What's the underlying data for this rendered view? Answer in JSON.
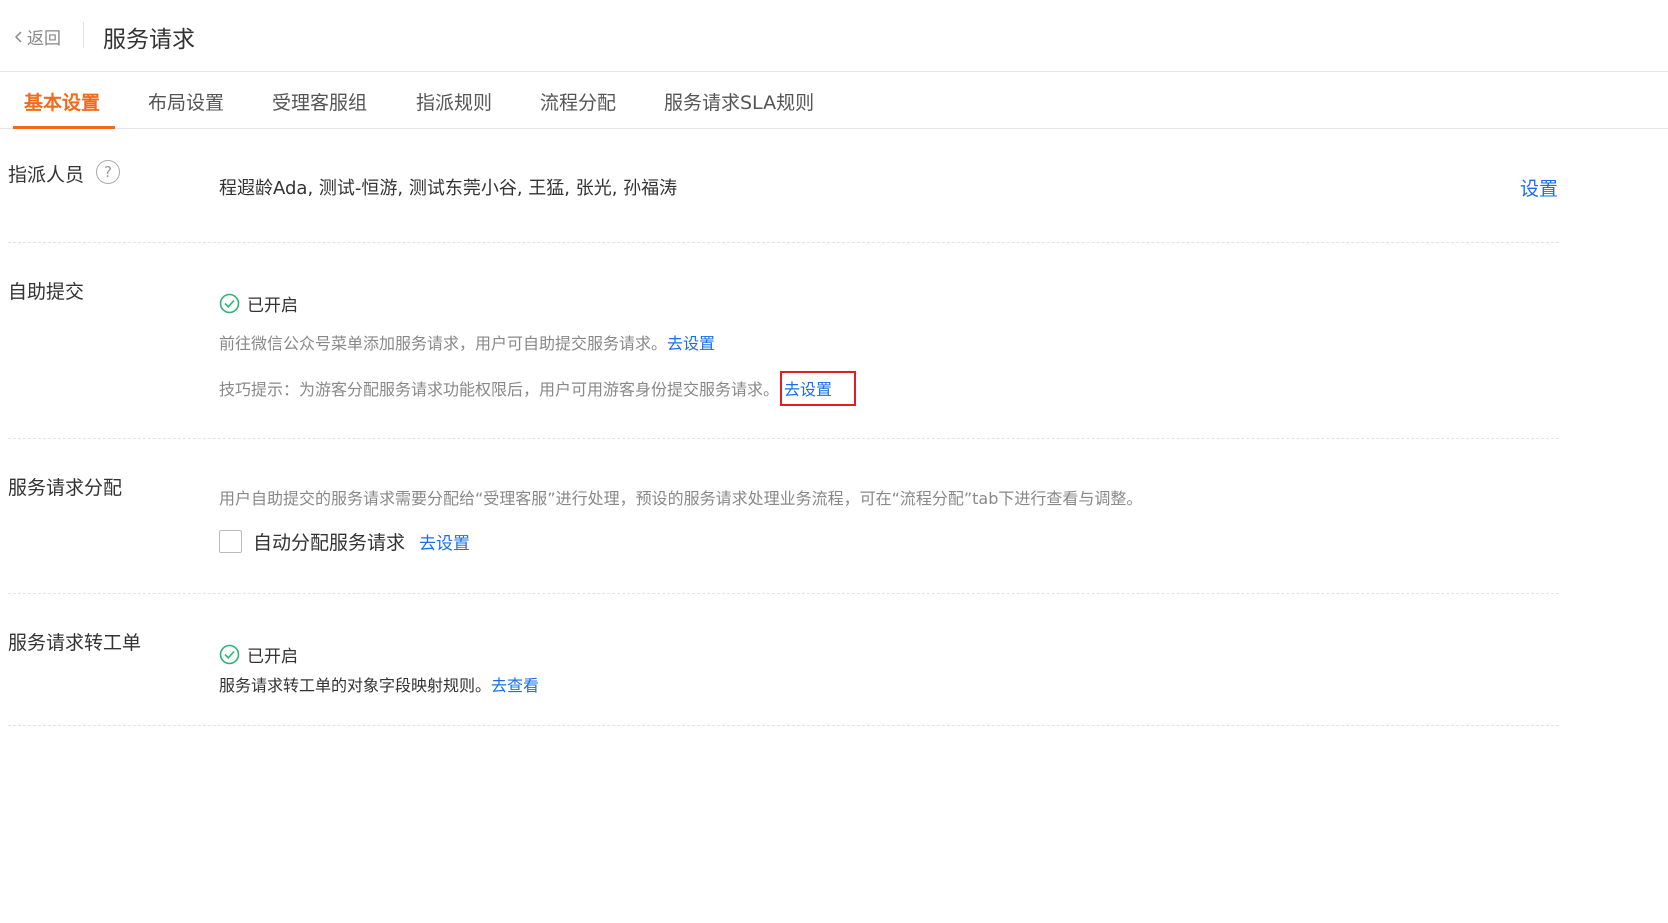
{
  "header": {
    "back_label": "返回",
    "title": "服务请求"
  },
  "tabs": [
    {
      "label": "基本设置",
      "active": true
    },
    {
      "label": "布局设置",
      "active": false
    },
    {
      "label": "受理客服组",
      "active": false
    },
    {
      "label": "指派规则",
      "active": false
    },
    {
      "label": "流程分配",
      "active": false
    },
    {
      "label": "服务请求SLA规则",
      "active": false
    }
  ],
  "assign": {
    "label": "指派人员",
    "help_icon": "?",
    "value": "程遐龄Ada, 测试-恒游, 测试东莞小谷, 王猛, 张光, 孙福涛",
    "action": "设置"
  },
  "self_submit": {
    "label": "自助提交",
    "status": "已开启",
    "hint1": "前往微信公众号菜单添加服务请求，用户可自助提交服务请求。",
    "hint1_link": "去设置",
    "hint2": "技巧提示：为游客分配服务请求功能权限后，用户可用游客身份提交服务请求。",
    "hint2_link": "去设置"
  },
  "distribution": {
    "label": "服务请求分配",
    "description": "用户自助提交的服务请求需要分配给“受理客服”进行处理，预设的服务请求处理业务流程，可在“流程分配”tab下进行查看与调整。",
    "checkbox_label": "自动分配服务请求",
    "checkbox_checked": false,
    "link": "去设置"
  },
  "convert": {
    "label": "服务请求转工单",
    "status": "已开启",
    "description": "服务请求转工单的对象字段映射规则。",
    "link": "去查看"
  },
  "colors": {
    "accent": "#f26b1d",
    "link": "#1a6fe8",
    "success": "#2bb673",
    "highlight_box": "#e02020"
  },
  "icons": {
    "back": "chevron-left-icon",
    "help": "question-circle-icon",
    "status": "check-circle-icon"
  }
}
